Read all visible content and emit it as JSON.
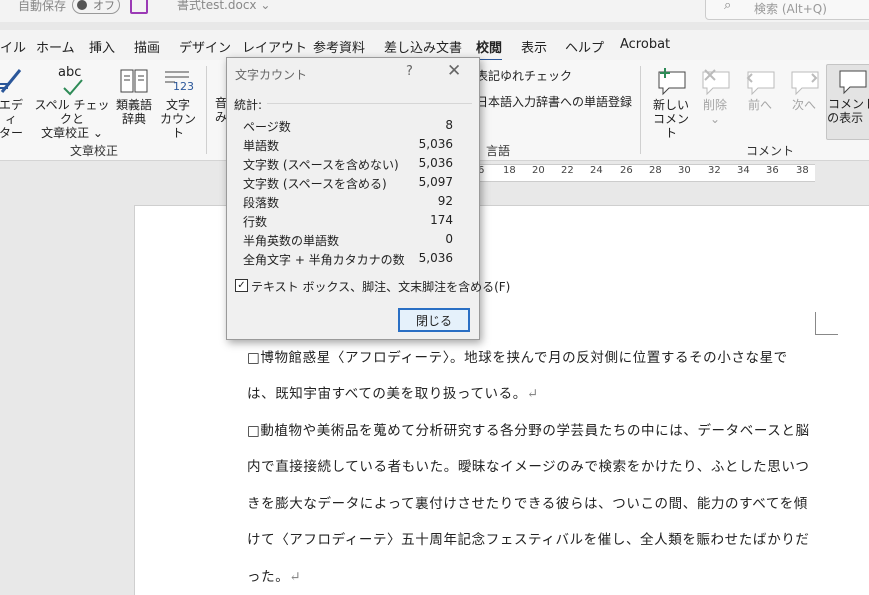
{
  "titlebar": {
    "autosave_label": "自動保存",
    "autosave_state": "オフ",
    "filename": "書式test.docx ⌄",
    "search_placeholder": "検索 (Alt+Q)"
  },
  "tabs": [
    "イル",
    "ホーム",
    "挿入",
    "描画",
    "デザイン",
    "レイアウト",
    "参考資料",
    "差し込み文書",
    "校閲",
    "表示",
    "ヘルプ",
    "Acrobat"
  ],
  "active_tab": "校閲",
  "ribbon": {
    "editor": {
      "line1": "エディ",
      "line2": "ター"
    },
    "spelling": {
      "line1": "スペル チェックと",
      "line2": "文章校正 ⌄",
      "icon_text": "abc"
    },
    "thesaurus": {
      "line1": "類義語",
      "line2": "辞典"
    },
    "wordcount": {
      "line1": "文字",
      "line2": "カウント",
      "icon_text": "123"
    },
    "proofing_group": "文章校正",
    "ambiguity_check": "表記ゆれチェック",
    "jp_dictionary": "日本語入力辞書への単語登録",
    "language_group": "言語",
    "new_comment": {
      "line1": "新しい",
      "line2": "コメント"
    },
    "delete": {
      "line1": "削除",
      "line2": "⌄"
    },
    "prev": "前へ",
    "next": "次へ",
    "show_comments": {
      "line1": "コメント",
      "line2": "の表示 ⌄"
    },
    "comment_group": "コメント",
    "partial_left": {
      "line1": "音",
      "line2": "み"
    }
  },
  "ruler": [
    "6",
    "18",
    "20",
    "22",
    "24",
    "26",
    "28",
    "30",
    "32",
    "34",
    "36",
    "38"
  ],
  "document": {
    "lines": [
      "□博物館惑星〈アフロディーテ〉。地球を挟んで月の反対側に位置するその小さな星で",
      "は、既知宇宙すべての美を取り扱っている。",
      "□動植物や美術品を蒐めて分析研究する各分野の学芸員たちの中には、データベースと脳",
      "内で直接接続している者もいた。曖昧なイメージのみで検索をかけたり、ふとした思いつ",
      "きを膨大なデータによって裏付けさせたりできる彼らは、ついこの間、能力のすべてを傾",
      "けて〈アフロディーテ〉五十周年記念フェスティバルを催し、全人類を賑わせたばかりだ",
      "った。"
    ],
    "paragraph_mark": "↵"
  },
  "dialog": {
    "title": "文字カウント",
    "help": "?",
    "close": "✕",
    "stats_header": "統計:",
    "stats": [
      {
        "label": "ページ数",
        "value": "8"
      },
      {
        "label": "単語数",
        "value": "5,036"
      },
      {
        "label": "文字数 (スペースを含めない)",
        "value": "5,036"
      },
      {
        "label": "文字数 (スペースを含める)",
        "value": "5,097"
      },
      {
        "label": "段落数",
        "value": "92"
      },
      {
        "label": "行数",
        "value": "174"
      },
      {
        "label": "半角英数の単語数",
        "value": "0"
      },
      {
        "label": "全角文字 + 半角カタカナの数",
        "value": "5,036"
      }
    ],
    "checkbox_label": "テキスト ボックス、脚注、文末脚注を含める(F)",
    "checkbox_checked": true,
    "close_button": "閉じる"
  }
}
